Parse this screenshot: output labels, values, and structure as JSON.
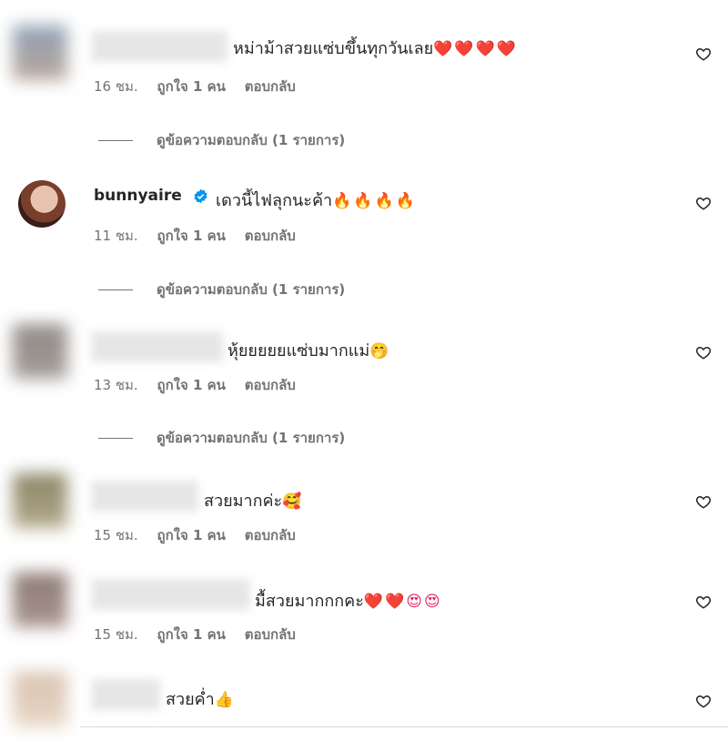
{
  "comments": [
    {
      "text": "หม่าม้าสวยแซ่บขึ้นทุกวันเลย",
      "emoji": "❤️❤️❤️❤️",
      "time": "16 ชม.",
      "likes": "ถูกใจ 1 คน",
      "reply": "ตอบกลับ",
      "view_replies": "ดูข้อความตอบกลับ (1 รายการ)"
    },
    {
      "username": "bunnyaire",
      "text": "เดวนี้ไฟลุกนะค้า",
      "emoji": "🔥🔥🔥🔥",
      "time": "11 ชม.",
      "likes": "ถูกใจ 1 คน",
      "reply": "ตอบกลับ",
      "view_replies": "ดูข้อความตอบกลับ (1 รายการ)"
    },
    {
      "text": "หุ้ยยยยยแซ่บมากแม่",
      "emoji": "🤭",
      "time": "13 ชม.",
      "likes": "ถูกใจ 1 คน",
      "reply": "ตอบกลับ",
      "view_replies": "ดูข้อความตอบกลับ (1 รายการ)"
    },
    {
      "text": "สวยมากค่ะ",
      "emoji": "🥰",
      "time": "15 ชม.",
      "likes": "ถูกใจ 1 คน",
      "reply": "ตอบกลับ"
    },
    {
      "text": "มื้สวยมากกกคะ",
      "emoji": "❤️❤️😍😍",
      "time": "15 ชม.",
      "likes": "ถูกใจ 1 คน",
      "reply": "ตอบกลับ"
    },
    {
      "text": "สวยค่ำ",
      "emoji": "👍"
    }
  ],
  "icons": {
    "like": "heart-outline-icon",
    "verified": "verified-badge-icon"
  },
  "colors": {
    "verified": "#0095f6",
    "meta": "#737373",
    "text": "#262626"
  }
}
